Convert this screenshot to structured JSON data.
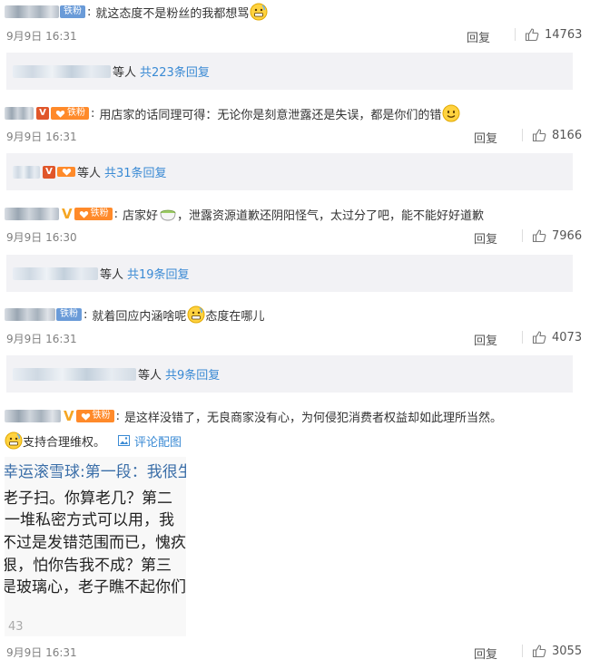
{
  "comments": [
    {
      "text": "就这态度不是粉丝的我都想骂",
      "badge": "铁粉",
      "emoji": "grimace-emoji",
      "time": "9月9日 16:31",
      "reply_label": "回复",
      "likes": "14763",
      "replies_summary": {
        "prefix": "等人",
        "link": "共223条回复"
      }
    },
    {
      "text": "用店家的话同理可得：无论你是刻意泄露还是失误，都是你们的错",
      "badge": "铁粉",
      "emoji": "smile-emoji",
      "time": "9月9日 16:31",
      "reply_label": "回复",
      "likes": "8166",
      "replies_summary": {
        "prefix": "等人",
        "link": "共31条回复"
      }
    },
    {
      "text_before": "店家好",
      "text_after": "，泄露资源道歉还阴阳怪气，太过分了吧，能不能好好道歉",
      "badge": "铁粉",
      "emoji": "bowl-emoji",
      "time": "9月9日 16:30",
      "reply_label": "回复",
      "likes": "7966",
      "replies_summary": {
        "prefix": "等人",
        "link": "共19条回复"
      }
    },
    {
      "text_before": "就着回应内涵啥呢",
      "text_after": "态度在哪儿",
      "badge": "铁粉",
      "emoji": "grimace-emoji",
      "time": "9月9日 16:31",
      "reply_label": "回复",
      "likes": "4073",
      "replies_summary": {
        "prefix": "等人",
        "link": "共9条回复"
      }
    },
    {
      "text": "是这样没错了，无良商家没有心，为何侵犯消费者权益却如此理所当然。",
      "text_line2": "支持合理维权。",
      "badge": "铁粉",
      "emoji": "grimace-emoji",
      "pic_link": "评论配图",
      "image_text": [
        "幸运滚雪球:第一段：我很生",
        "老子扫。你算老几？第二",
        "一堆私密方式可以用，我",
        "不过是发错范围而已，愧疚",
        "狠，怕你告我不成？第三",
        "是玻璃心，老子瞧不起你们",
        "43"
      ],
      "time": "9月9日 16:31",
      "reply_label": "回复",
      "likes": "3055"
    }
  ],
  "icons": {
    "like": "thumbs-up-icon",
    "pic": "image-icon",
    "verified": "v-badge-icon",
    "heart": "fan-heart-icon"
  },
  "colors": {
    "link": "#3a8ad4",
    "fan_badge_blue": "#6a9bd8",
    "fan_badge_orange": "#ff8a2a",
    "reply_box_bg": "#f2f2f5",
    "time_text": "#808080"
  }
}
